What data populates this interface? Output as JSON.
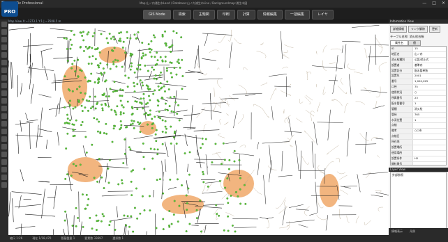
{
  "app": {
    "title": "STAFix Professional",
    "logo_text": "PRO",
    "document_path": "Map:山ノ内浦生市Land / Database:山ノ内浦生市Line / Backgroundmap:浦生市図"
  },
  "window_buttons": [
    "—",
    "□",
    "✕"
  ],
  "menu": [
    {
      "label": "GIS Mode",
      "active": true
    },
    {
      "label": "検索",
      "active": false
    },
    {
      "label": "主題図",
      "active": false
    },
    {
      "label": "印刷",
      "active": false
    },
    {
      "label": "計算",
      "active": false
    },
    {
      "label": "情報編集",
      "active": false
    },
    {
      "label": "一括編集",
      "active": false
    },
    {
      "label": "レイヤ",
      "active": false
    }
  ],
  "map_header": "Map View  X:~1273.1 Y:1 | ~7608.5 m",
  "colors": {
    "chrome": "#2a2a2a",
    "pipe": "#1a1a1a",
    "node": "#5ec43a",
    "area": "#f0a868",
    "contour": "#b8a890"
  },
  "info_panel": {
    "header": "Information View",
    "buttons": [
      "詳細情報",
      "リンク解除",
      "更新"
    ],
    "table_label": "テーブル名称: 消火栓台帳",
    "tabs": [
      "属性名",
      "値"
    ],
    "rows": [
      {
        "key": "ID",
        "value": "15"
      },
      {
        "key": "地区名",
        "value": "山ノ内"
      },
      {
        "key": "消火栓種別",
        "value": "公設/地上式"
      },
      {
        "key": "設置者",
        "value": "基準内"
      },
      {
        "key": "設置区分",
        "value": "配水管単独"
      },
      {
        "key": "設置年",
        "value": "2001"
      },
      {
        "key": "番号",
        "value": "1,000,025"
      },
      {
        "key": "口径",
        "value": "75"
      },
      {
        "key": "使用状況",
        "value": "○"
      },
      {
        "key": "所属番号",
        "value": "23"
      },
      {
        "key": "配水管番号",
        "value": "1"
      },
      {
        "key": "管種",
        "value": "消火栓"
      },
      {
        "key": "管径",
        "value": "765"
      },
      {
        "key": "水深位置",
        "value": "1"
      },
      {
        "key": "点検",
        "value": ""
      },
      {
        "key": "備考",
        "value": "○○市"
      },
      {
        "key": "点検日",
        "value": ""
      },
      {
        "key": "所在地",
        "value": ""
      },
      {
        "key": "設置場所",
        "value": ""
      },
      {
        "key": "使用場所",
        "value": ""
      },
      {
        "key": "設置条件",
        "value": "H2"
      },
      {
        "key": "開栓番号",
        "value": ""
      },
      {
        "key": "消火栓地番",
        "value": ""
      },
      {
        "key": "消火栓口径",
        "value": "399"
      },
      {
        "key": "消火栓圧力",
        "value": ""
      },
      {
        "key": "消火栓形式",
        "value": ""
      }
    ]
  },
  "layer_panel": {
    "header": "Layer View",
    "items": [
      "外部参照"
    ]
  },
  "panel_footer": [
    "情報表示",
    "凡例"
  ],
  "status": [
    "縮尺 1:26",
    "現在 1/18,470",
    "管基盤量 1",
    "要素数 33697",
    "選択数 1"
  ]
}
